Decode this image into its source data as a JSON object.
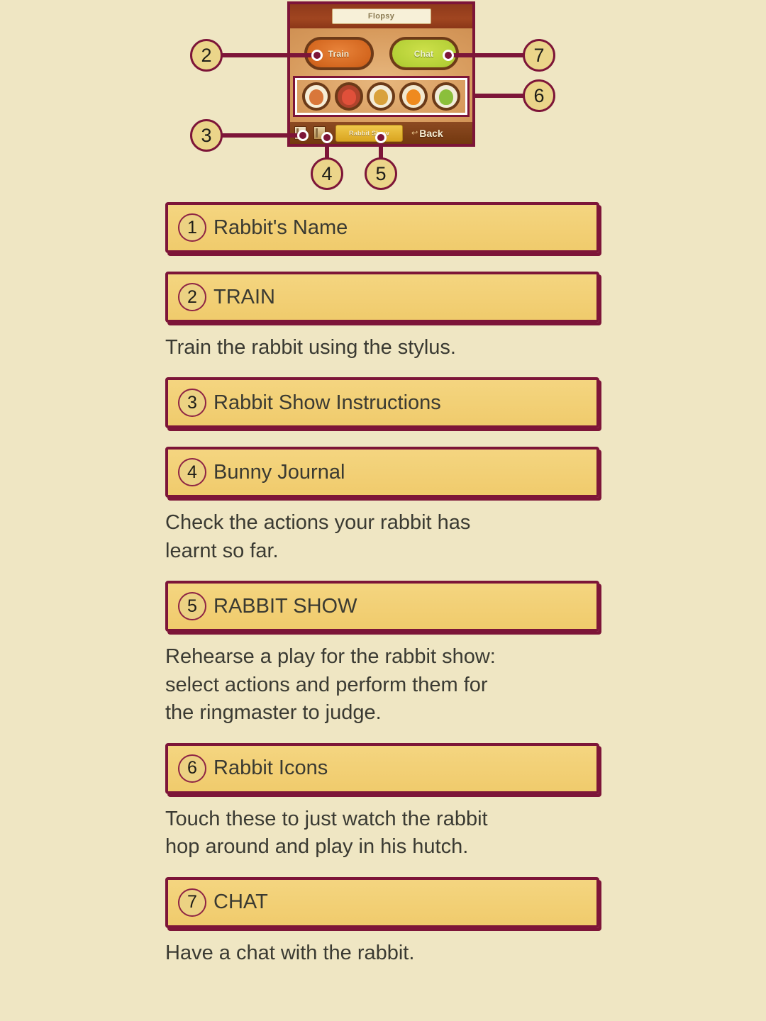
{
  "background_color": "#efe6c3",
  "accent_color": "#7d1538",
  "bar_fill_color": "#f2d078",
  "screenshot": {
    "name_field": {
      "value": "Flopsy"
    },
    "buttons": [
      {
        "id": "train",
        "label": "Train",
        "color": "#d4671f"
      },
      {
        "id": "chat",
        "label": "Chat",
        "color": "#b5d037"
      }
    ],
    "rabbit_icons": [
      {
        "id": "rabbit-icon-1"
      },
      {
        "id": "rabbit-icon-2"
      },
      {
        "id": "rabbit-icon-3"
      },
      {
        "id": "rabbit-icon-4"
      },
      {
        "id": "rabbit-icon-5"
      }
    ],
    "bottom_bar": {
      "instructions_icon": "rabbit-show-instructions-icon",
      "journal_icon": "bunny-journal-icon",
      "rabbit_show_label": "Rabbit Show",
      "back_label": "Back",
      "back_arrow": "↩"
    }
  },
  "callouts": [
    {
      "number": "2"
    },
    {
      "number": "3"
    },
    {
      "number": "4"
    },
    {
      "number": "5"
    },
    {
      "number": "6"
    },
    {
      "number": "7"
    }
  ],
  "legend": [
    {
      "number": "1",
      "label": "Rabbit's Name",
      "description": null
    },
    {
      "number": "2",
      "label": "TRAIN",
      "description": "Train the rabbit using the stylus."
    },
    {
      "number": "3",
      "label": "Rabbit Show Instructions",
      "description": null
    },
    {
      "number": "4",
      "label": "Bunny Journal",
      "description": "Check the actions your rabbit has\nlearnt so far."
    },
    {
      "number": "5",
      "label": "RABBIT SHOW",
      "description": "Rehearse a play for the rabbit show:\nselect actions and perform them for\nthe ringmaster to judge."
    },
    {
      "number": "6",
      "label": "Rabbit Icons",
      "description": "Touch these to just watch the rabbit\nhop around and play in his hutch."
    },
    {
      "number": "7",
      "label": "CHAT",
      "description": "Have a chat with the rabbit."
    }
  ]
}
